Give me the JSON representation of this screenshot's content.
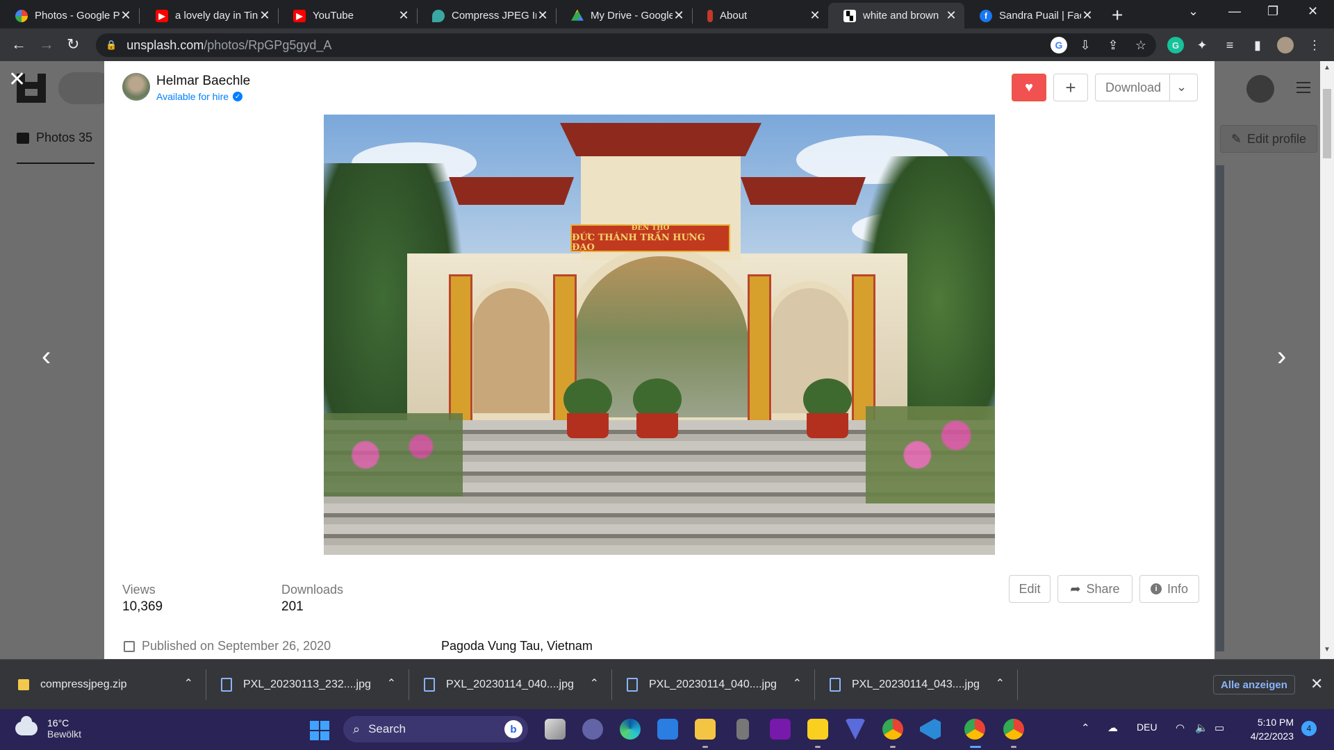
{
  "browser": {
    "tabs": [
      {
        "title": "Photos - Google P",
        "favicon_color": "#fbbc04"
      },
      {
        "title": "a lovely day in Tin",
        "favicon_color": "#ff0000"
      },
      {
        "title": "YouTube",
        "favicon_color": "#ff0000"
      },
      {
        "title": "Compress JPEG Im",
        "favicon_color": "#3aa7a3"
      },
      {
        "title": "My Drive - Google",
        "favicon_color": "#34a853"
      },
      {
        "title": "About",
        "favicon_color": "#c0392b"
      },
      {
        "title": "white and brown",
        "favicon_color": "#ffffff"
      },
      {
        "title": "Sandra Puail | Fac",
        "favicon_color": "#1877f2"
      }
    ],
    "active_tab_index": 6,
    "url_host": "unsplash.com",
    "url_path": "/photos/RpGPg5gyd_A"
  },
  "background_page": {
    "photos_tab_label": "Photos 35",
    "edit_profile_label": "Edit profile"
  },
  "modal": {
    "author_name": "Helmar Baechle",
    "author_status": "Available for hire",
    "download_label": "Download",
    "photo_sign_line1": "ĐỀN THỜ",
    "photo_sign_line2": "ĐỨC THÁNH TRẦN HƯNG ĐẠO",
    "stats": {
      "views_label": "Views",
      "views_value": "10,369",
      "downloads_label": "Downloads",
      "downloads_value": "201"
    },
    "actions": {
      "edit": "Edit",
      "share": "Share",
      "info": "Info"
    },
    "published": "Published on September 26, 2020",
    "location": "Pagoda Vung Tau, Vietnam"
  },
  "downloads_shelf": {
    "items": [
      {
        "name": "compressjpeg.zip",
        "icon": "zip-folder-icon"
      },
      {
        "name": "PXL_20230113_232....jpg",
        "icon": "image-file-icon"
      },
      {
        "name": "PXL_20230114_040....jpg",
        "icon": "image-file-icon"
      },
      {
        "name": "PXL_20230114_040....jpg",
        "icon": "image-file-icon"
      },
      {
        "name": "PXL_20230114_043....jpg",
        "icon": "image-file-icon"
      }
    ],
    "show_all_label": "Alle anzeigen"
  },
  "taskbar": {
    "weather_temp": "16°C",
    "weather_desc": "Bewölkt",
    "search_label": "Search",
    "language": "DEU",
    "time": "5:10 PM",
    "date": "4/22/2023",
    "notification_count": "4"
  }
}
